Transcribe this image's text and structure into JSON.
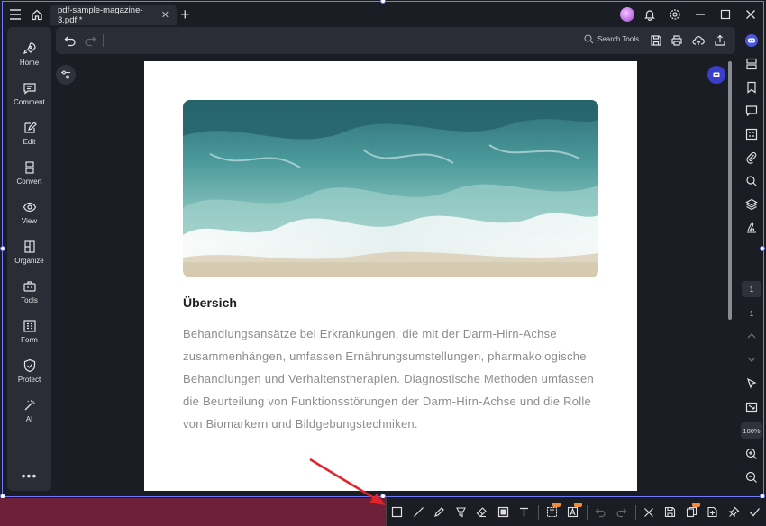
{
  "titlebar": {
    "tab_title": "pdf-sample-magazine-3.pdf *",
    "tab_close": "✕",
    "new_tab": "+"
  },
  "sidebar": {
    "items": [
      {
        "label": "Home",
        "icon": "rocket-icon"
      },
      {
        "label": "Comment",
        "icon": "comment-icon"
      },
      {
        "label": "Edit",
        "icon": "edit-icon"
      },
      {
        "label": "Convert",
        "icon": "convert-icon"
      },
      {
        "label": "View",
        "icon": "eye-icon"
      },
      {
        "label": "Organize",
        "icon": "organize-icon"
      },
      {
        "label": "Tools",
        "icon": "toolbox-icon"
      },
      {
        "label": "Form",
        "icon": "form-icon"
      },
      {
        "label": "Protect",
        "icon": "shield-icon"
      },
      {
        "label": "AI",
        "icon": "magic-wand-icon"
      }
    ],
    "more": "•••"
  },
  "toolbar": {
    "search_label": "Search Tools"
  },
  "document": {
    "heading": "Übersich",
    "paragraph": "Behandlungsansätze bei Erkrankungen, die mit der Darm-Hirn-Achse zusammenhängen, umfassen Ernährungsumstellungen, pharmakologische Behandlungen und Verhaltenstherapien. Diagnostische Methoden umfassen die Beurteilung von Funktionsstörungen der Darm-Hirn-Achse und die Rolle von Biomarkern und Bildgebungstechniken."
  },
  "rightrail": {
    "current_page": "1",
    "total_pages": "1",
    "zoom": "100%"
  },
  "colors": {
    "accent": "#6f7bf7",
    "background": "#1b1d24",
    "panel": "#2a2d36",
    "taskbar": "#6e1f3a",
    "pro_badge": "#f08b3a"
  }
}
